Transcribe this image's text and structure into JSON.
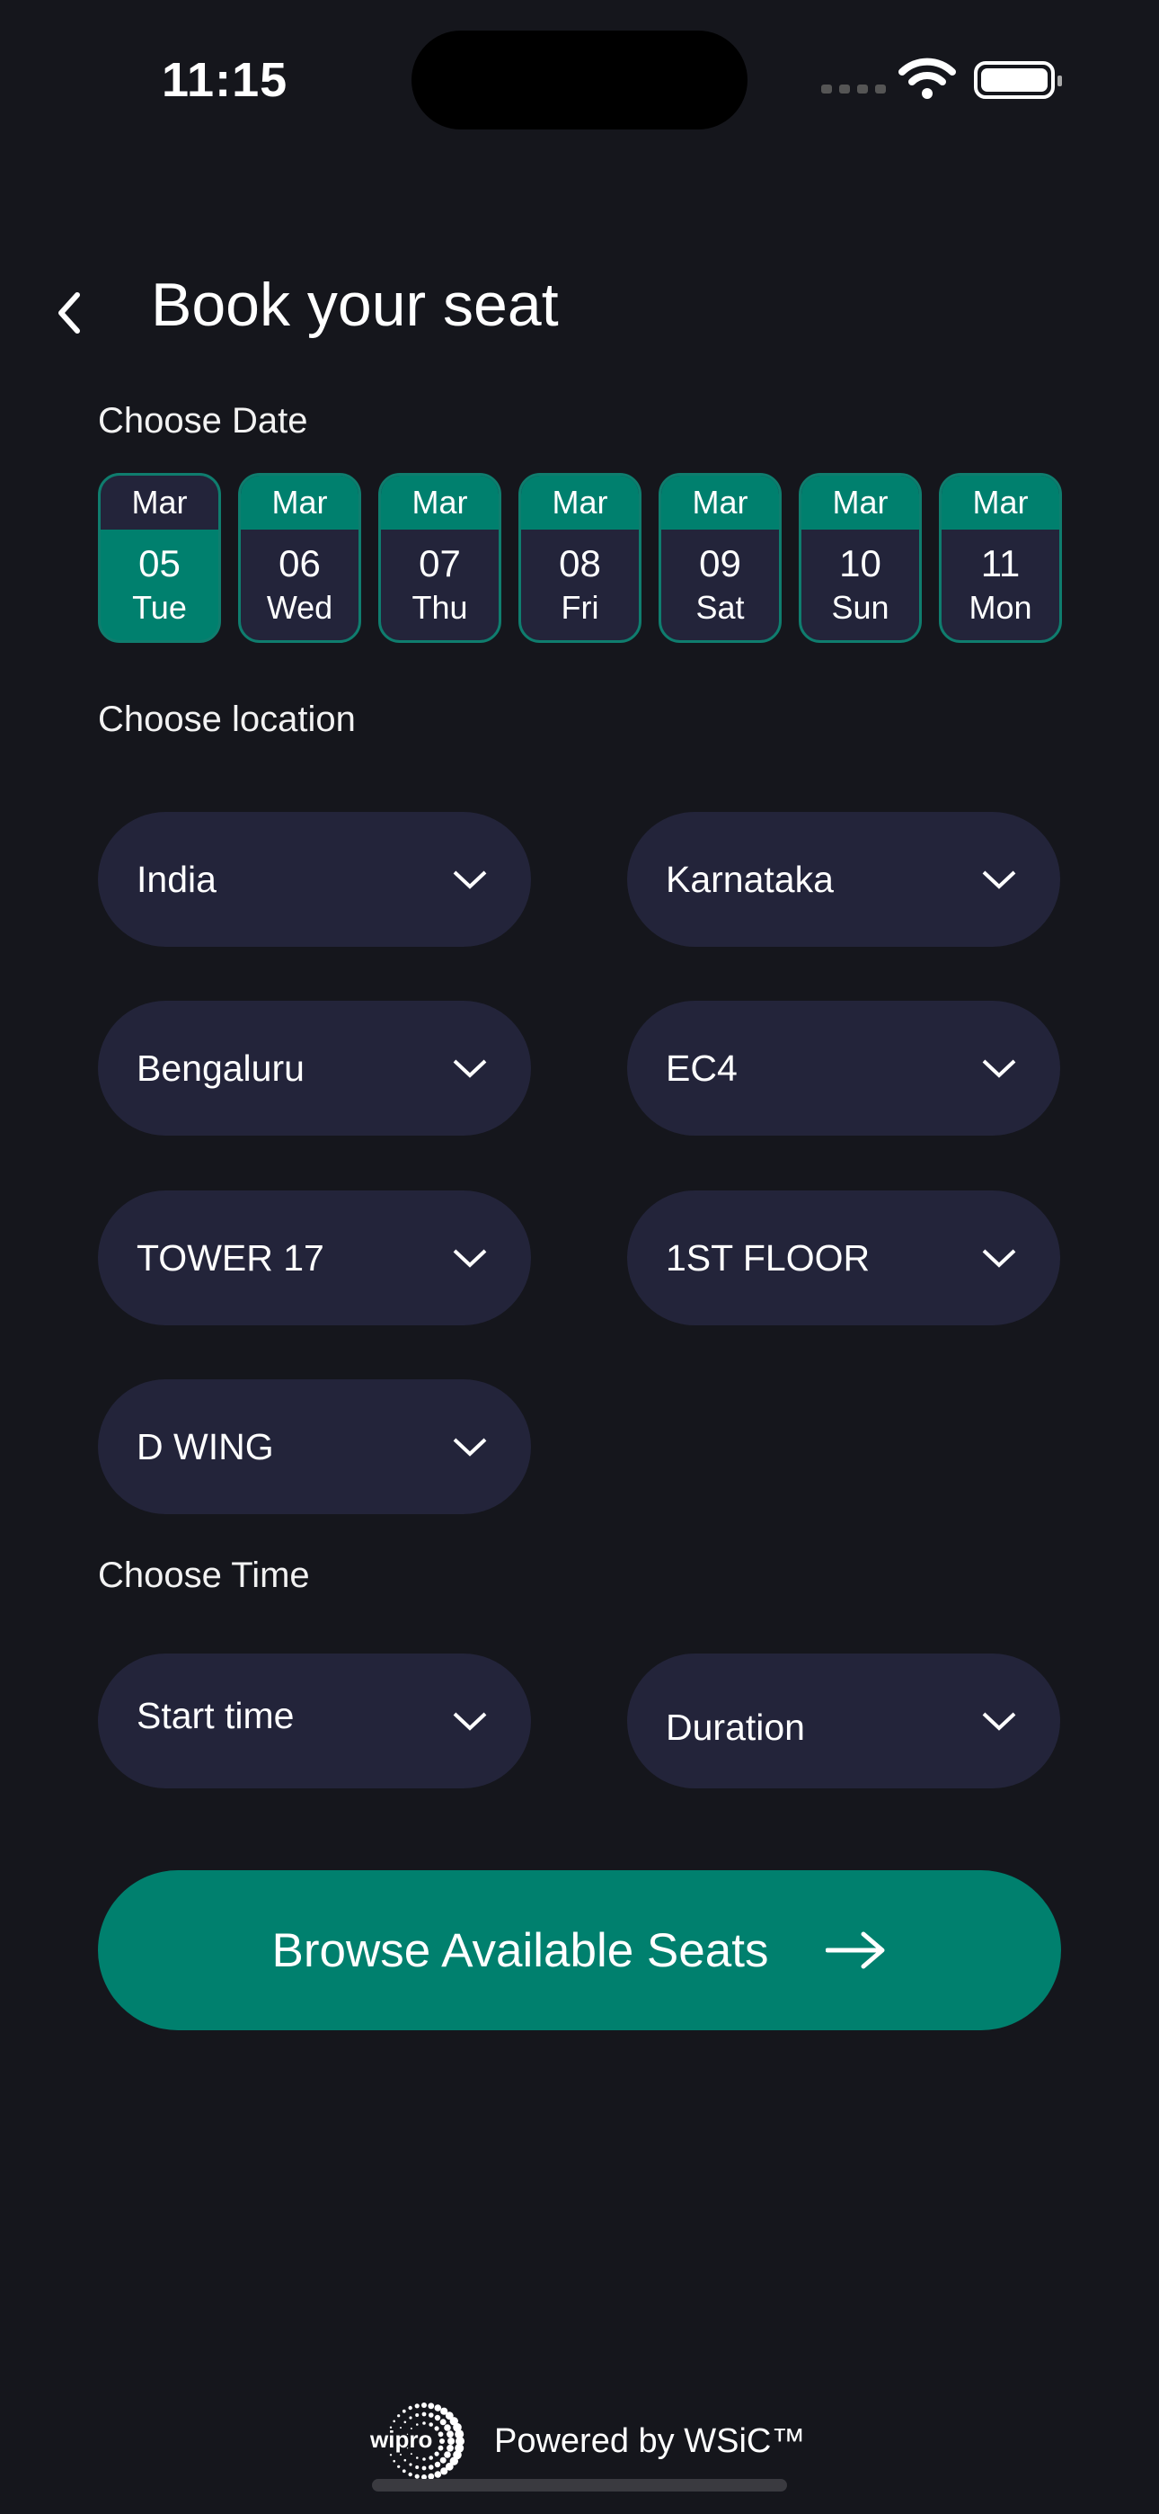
{
  "status_bar": {
    "time": "11:15"
  },
  "header": {
    "title": "Book your seat"
  },
  "date_section": {
    "label": "Choose Date",
    "dates": [
      {
        "month": "Mar",
        "day": "05",
        "weekday": "Tue",
        "selected": true
      },
      {
        "month": "Mar",
        "day": "06",
        "weekday": "Wed",
        "selected": false
      },
      {
        "month": "Mar",
        "day": "07",
        "weekday": "Thu",
        "selected": false
      },
      {
        "month": "Mar",
        "day": "08",
        "weekday": "Fri",
        "selected": false
      },
      {
        "month": "Mar",
        "day": "09",
        "weekday": "Sat",
        "selected": false
      },
      {
        "month": "Mar",
        "day": "10",
        "weekday": "Sun",
        "selected": false
      },
      {
        "month": "Mar",
        "day": "11",
        "weekday": "Mon",
        "selected": false
      }
    ]
  },
  "location_section": {
    "label": "Choose location",
    "country": "India",
    "state": "Karnataka",
    "city": "Bengaluru",
    "campus": "EC4",
    "tower": "TOWER 17",
    "floor": "1ST FLOOR",
    "wing": "D WING"
  },
  "time_section": {
    "label": "Choose Time",
    "start_placeholder": "Start time",
    "duration_placeholder": "Duration"
  },
  "browse_button": {
    "label": "Browse Available Seats"
  },
  "footer": {
    "logo_text": "wipro",
    "powered_by": "Powered by WSiC™"
  },
  "colors": {
    "accent": "#00806e",
    "background": "#15161c",
    "surface": "#23243a"
  }
}
